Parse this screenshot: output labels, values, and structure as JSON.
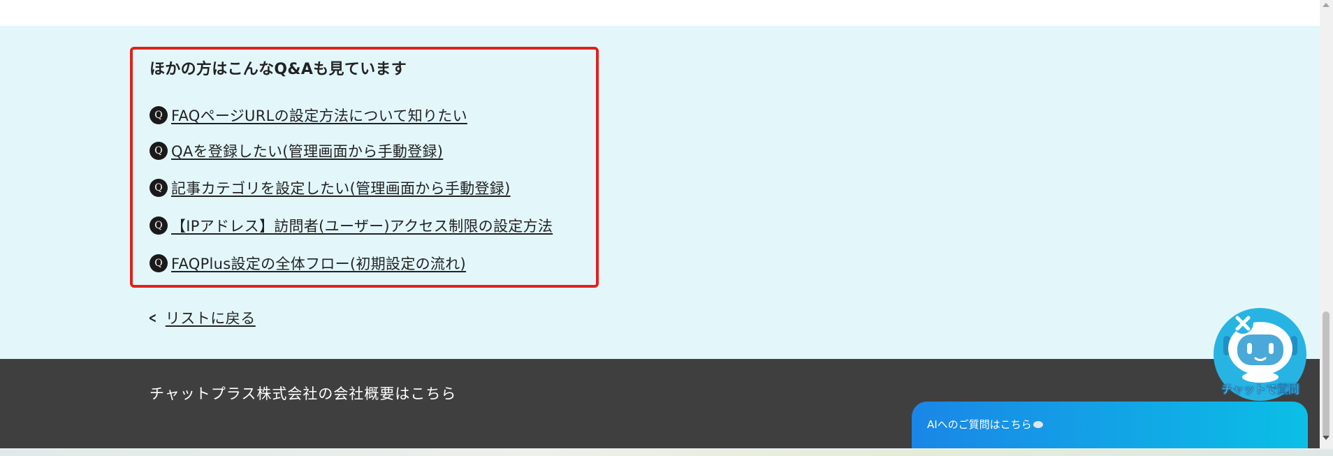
{
  "colors": {
    "main_bg": "#e3f7fb",
    "highlight_border": "#e0211b",
    "q_badge": "#1a1a1a",
    "footer_bg": "#3f3f3f",
    "chat_bar_gradient_start": "#1a86e6",
    "chat_bar_gradient_end": "#0bbfe6",
    "bot_circle": "#28b4e3"
  },
  "related": {
    "title": "ほかの方はこんなQ&Aも見ています",
    "q_badge_label": "Q",
    "items": [
      {
        "label": "FAQページURLの設定方法について知りたい"
      },
      {
        "label": "QAを登録したい(管理画面から手動登録)"
      },
      {
        "label": "記事カテゴリを設定したい(管理画面から手動登録)"
      },
      {
        "label": "【IPアドレス】訪問者(ユーザー)アクセス制限の設定方法"
      },
      {
        "label": "FAQPlus設定の全体フロー(初期設定の流れ)"
      }
    ]
  },
  "back": {
    "label": "リストに戻る",
    "icon": "chevron-left-icon"
  },
  "footer": {
    "company_link": "チャットプラス株式会社の会社概要はこちら"
  },
  "chat": {
    "bar_label": "AIへのご質問はこちら",
    "bar_icon": "speech-bubble-icon",
    "bot_label": "チャットで質問",
    "bot_icon": "robot-icon",
    "close_icon": "close-icon"
  }
}
